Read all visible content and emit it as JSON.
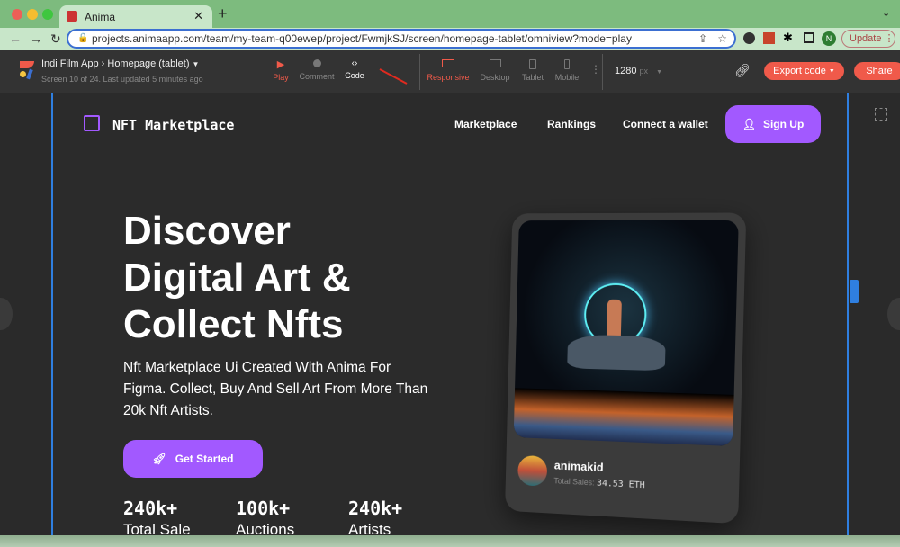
{
  "browser": {
    "tab_title": "Anima",
    "url": "projects.animaapp.com/team/my-team-q00ewep/project/FwmjkSJ/screen/homepage-tablet/omniview?mode=play",
    "update_label": "Update",
    "profile_initial": "N"
  },
  "toolbar": {
    "project": "Indi Film App",
    "screen": "Homepage (tablet)",
    "subtitle": "Screen 10 of 24. Last updated 5 minutes ago",
    "modes": [
      {
        "label": "Play",
        "icon": "play-icon"
      },
      {
        "label": "Comment",
        "icon": "comment-icon"
      },
      {
        "label": "Code",
        "icon": "code-icon"
      }
    ],
    "devices": [
      {
        "label": "Responsive"
      },
      {
        "label": "Desktop"
      },
      {
        "label": "Tablet"
      },
      {
        "label": "Mobile"
      }
    ],
    "width_value": "1280",
    "width_unit": "px",
    "export_label": "Export code",
    "share_label": "Share",
    "accent": "#f05a4a"
  },
  "site": {
    "logo": "NFT Marketplace",
    "nav": [
      "Marketplace",
      "Rankings",
      "Connect a wallet"
    ],
    "signup": "Sign Up",
    "hero_lines": [
      "Discover",
      "Digital Art &",
      "Collect Nfts"
    ],
    "description": "Nft Marketplace Ui Created With Anima For Figma. Collect, Buy And Sell Art From More Than 20k Nft Artists.",
    "cta": "Get Started",
    "stats": [
      {
        "value": "240k+",
        "label": "Total Sale"
      },
      {
        "value": "100k+",
        "label": "Auctions"
      },
      {
        "value": "240k+",
        "label": "Artists"
      }
    ],
    "card": {
      "artist": "animakid",
      "sales_label": "Total Sales:",
      "sales_value": "34.53 ETH"
    },
    "accent": "#a259ff"
  }
}
